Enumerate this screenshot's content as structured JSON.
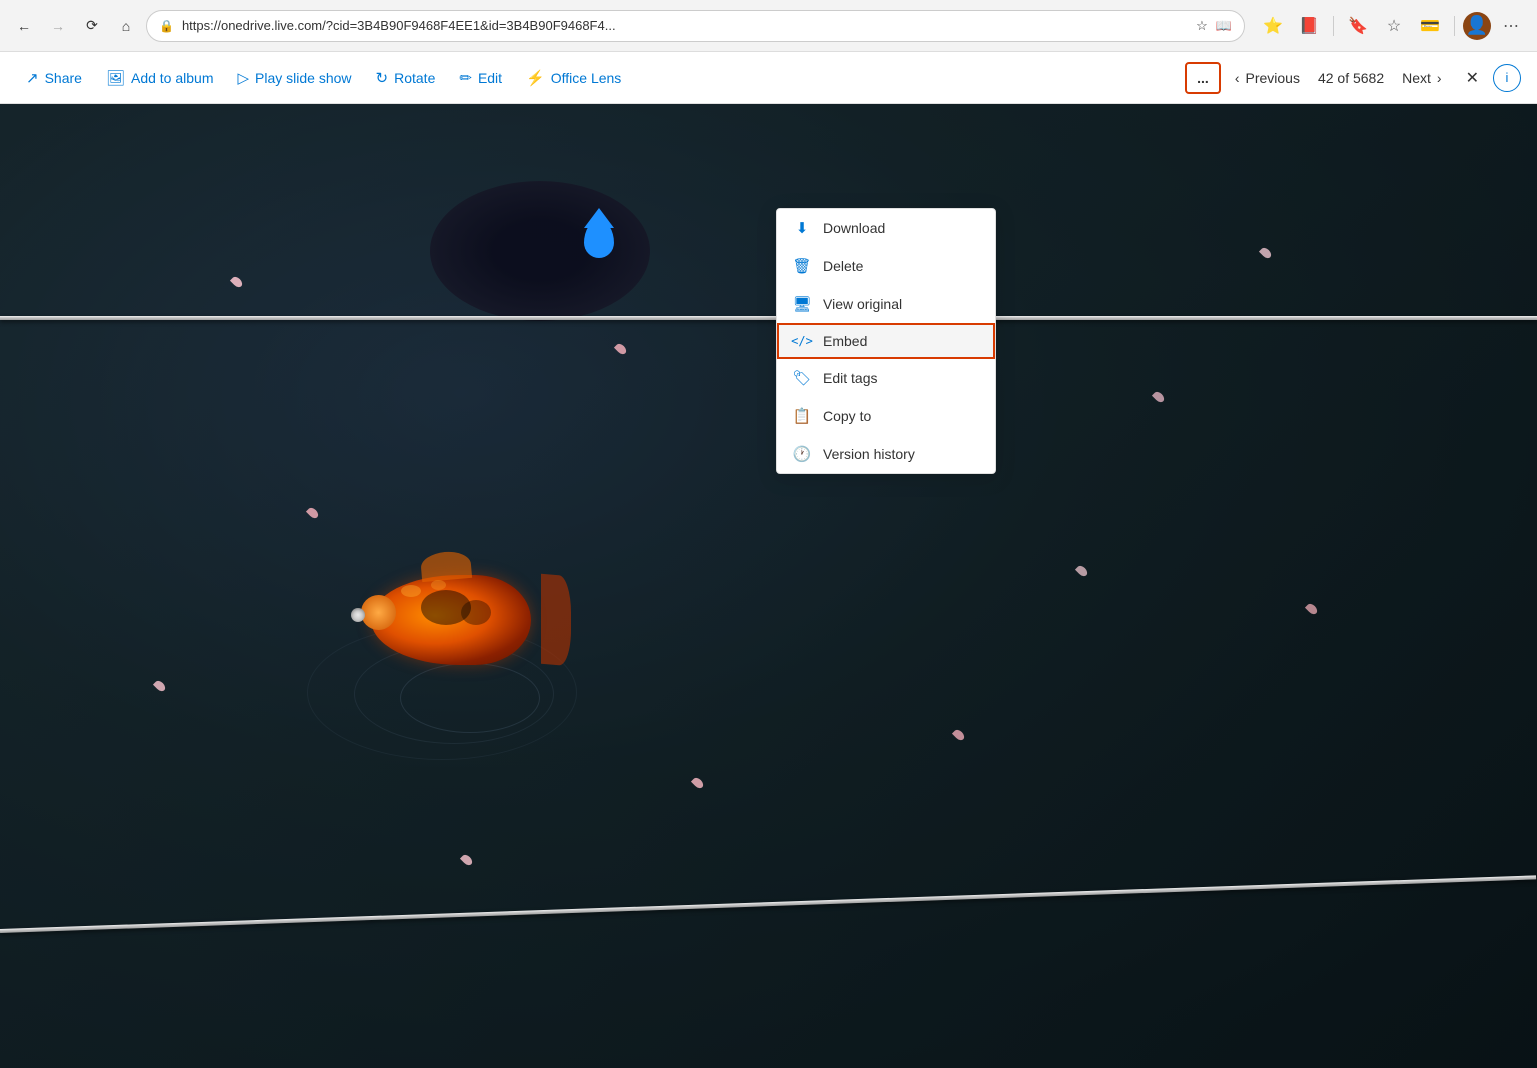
{
  "browser": {
    "back_tooltip": "Back",
    "forward_tooltip": "Forward",
    "refresh_tooltip": "Refresh",
    "home_tooltip": "Home",
    "url": "https://onedrive.live.com/?cid=3B4B90F9468F4EE1&id=3B4B90F9468F4...",
    "fav_tooltip": "Favorites",
    "read_tooltip": "Read aloud",
    "star_tooltip": "Add to favorites",
    "wallet_tooltip": "Wallet",
    "profile_tooltip": "Profile",
    "more_tooltip": "More"
  },
  "toolbar": {
    "share_label": "Share",
    "add_to_album_label": "Add to album",
    "play_slide_show_label": "Play slide show",
    "rotate_label": "Rotate",
    "edit_label": "Edit",
    "office_lens_label": "Office Lens",
    "more_label": "...",
    "previous_label": "Previous",
    "nav_count": "42 of 5682",
    "next_label": "Next",
    "close_label": "✕",
    "info_label": "ℹ"
  },
  "context_menu": {
    "items": [
      {
        "id": "download",
        "label": "Download",
        "icon": "⬇"
      },
      {
        "id": "delete",
        "label": "Delete",
        "icon": "🗑"
      },
      {
        "id": "view-original",
        "label": "View original",
        "icon": "🖥"
      },
      {
        "id": "embed",
        "label": "Embed",
        "icon": "</>",
        "highlighted": true
      },
      {
        "id": "edit-tags",
        "label": "Edit tags",
        "icon": "🏷"
      },
      {
        "id": "copy-to",
        "label": "Copy to",
        "icon": "📋"
      },
      {
        "id": "version-history",
        "label": "Version history",
        "icon": "🕐"
      }
    ]
  },
  "colors": {
    "accent": "#0078d4",
    "highlight_border": "#d83b01",
    "toolbar_bg": "#ffffff",
    "browser_bg": "#f3f3f3"
  }
}
